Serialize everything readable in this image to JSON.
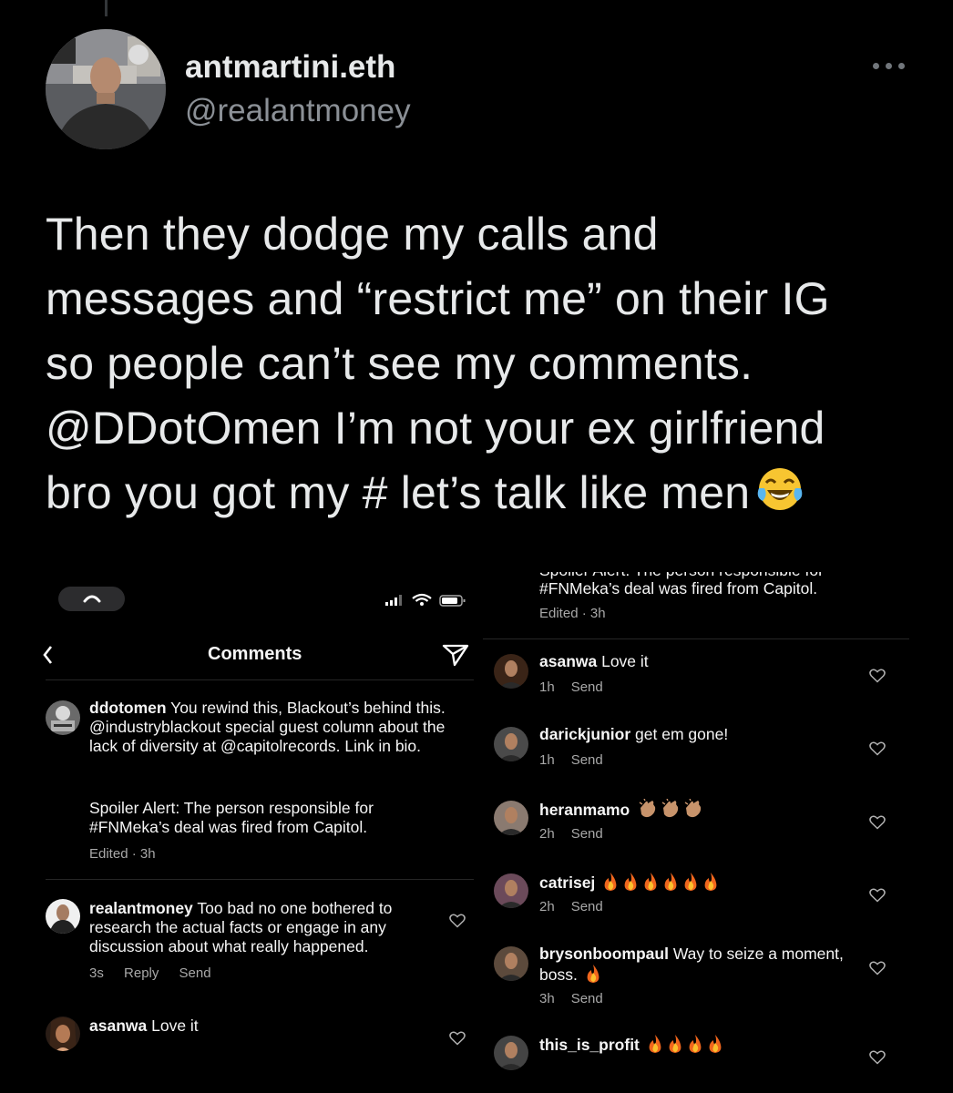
{
  "author": {
    "display_name": "antmartini.eth",
    "handle": "@realantmoney"
  },
  "tweet": {
    "lines": [
      "Then they dodge my calls and",
      "messages and “restrict me” on their IG",
      "so people can’t see my comments.",
      "@DDotOmen I’m not your ex girlfriend",
      "bro you got my # let’s talk like men"
    ],
    "emoji": "face-with-tears-of-joy"
  },
  "left_screenshot": {
    "header_title": "Comments",
    "caption": {
      "user": "ddotomen",
      "text": "You rewind this, Blackout’s behind this. @industryblackout special guest column about the lack of diversity at @capitolrecords. Link in bio.",
      "spoiler": "Spoiler Alert: The person responsible for #FNMeka’s deal was fired from Capitol.",
      "meta": "Edited · 3h"
    },
    "comments": [
      {
        "user": "realantmoney",
        "text": "Too bad no one bothered to research the actual facts or engage in any discussion about what really happened.",
        "time": "3s",
        "reply": "Reply",
        "send": "Send"
      },
      {
        "user": "asanwa",
        "text": "Love it"
      }
    ]
  },
  "right_screenshot": {
    "caption_cut": "Spoiler Alert: The person responsible for",
    "caption_rest": "#FNMeka’s deal was fired from Capitol.",
    "caption_meta": "Edited · 3h",
    "comments": [
      {
        "user": "asanwa",
        "text": "Love it",
        "time": "1h",
        "send": "Send",
        "emoji": ""
      },
      {
        "user": "darickjunior",
        "text": "get em gone!",
        "time": "1h",
        "send": "Send",
        "emoji": ""
      },
      {
        "user": "heranmamo",
        "text": "",
        "time": "2h",
        "send": "Send",
        "emoji": "clapping-hands x3"
      },
      {
        "user": "catrisej",
        "text": "",
        "time": "2h",
        "send": "Send",
        "emoji": "fire x6"
      },
      {
        "user": "brysonboompaul",
        "text": "Way to seize a moment, boss.",
        "time": "3h",
        "send": "Send",
        "emoji": "fire x1"
      },
      {
        "user": "this_is_profit",
        "text": "",
        "time": "",
        "send": "",
        "emoji": "fire x4"
      }
    ]
  },
  "colors": {
    "background": "#000000",
    "text": "#e7e9ea",
    "secondary": "#71767b"
  }
}
